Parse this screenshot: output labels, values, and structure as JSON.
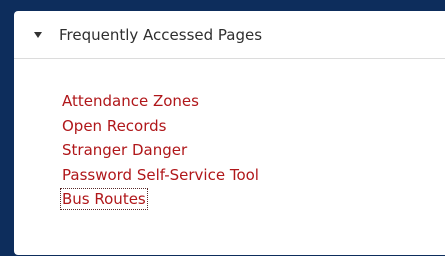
{
  "panel": {
    "title": "Frequently Accessed Pages",
    "toggle_icon": "caret-down-icon",
    "links": [
      {
        "label": "Attendance Zones"
      },
      {
        "label": "Open Records"
      },
      {
        "label": "Stranger Danger"
      },
      {
        "label": "Password Self-Service Tool"
      },
      {
        "label": "Bus Routes",
        "focused": true
      }
    ]
  },
  "colors": {
    "page_background": "#0d2d5c",
    "panel_background": "#ffffff",
    "link_color": "#b0171a",
    "title_color": "#2f2f2f",
    "divider": "#dcdcdc"
  }
}
